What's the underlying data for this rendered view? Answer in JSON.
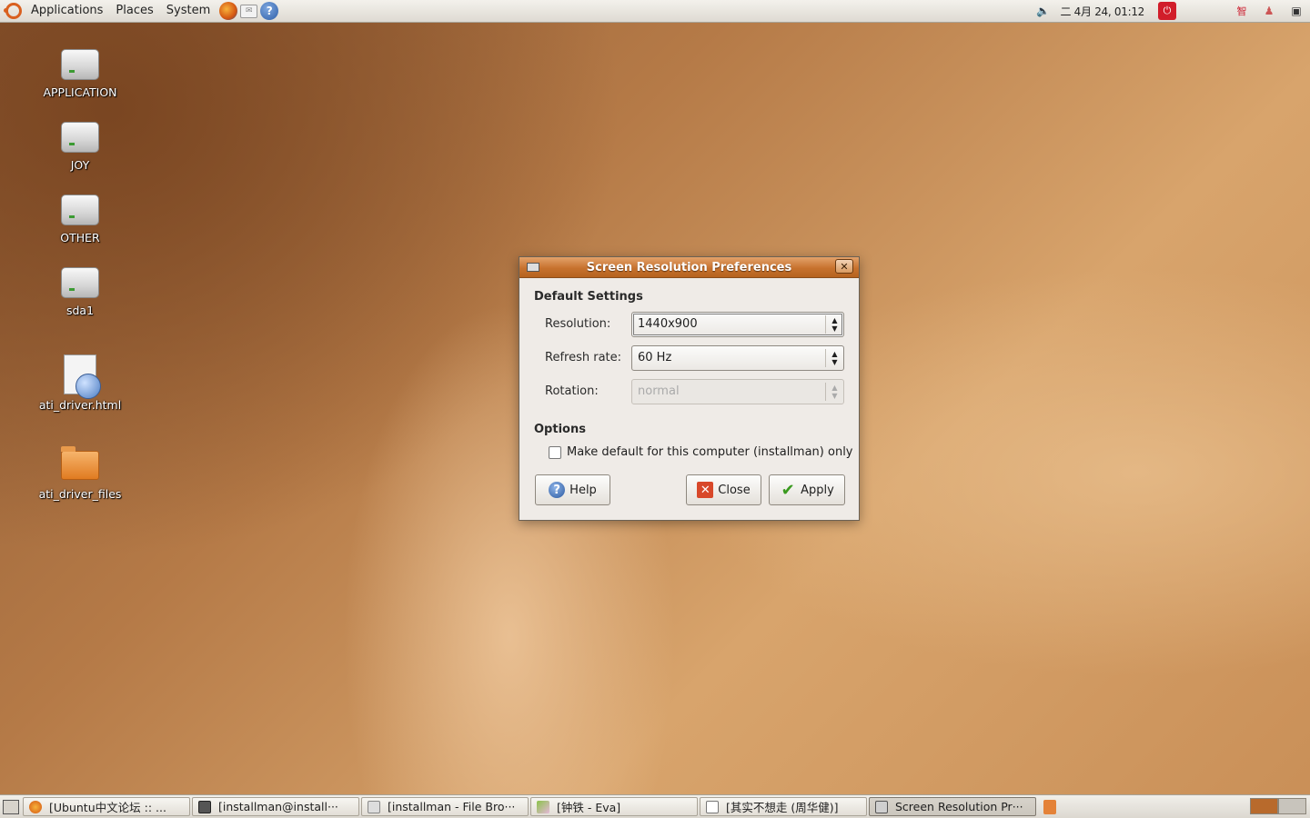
{
  "top_panel": {
    "menus": [
      "Applications",
      "Places",
      "System"
    ],
    "launchers": [
      "firefox-icon",
      "mail-icon",
      "help-icon"
    ],
    "clock": "二 4月 24, 01:12",
    "tray_icons": [
      "volume-icon",
      "power-icon",
      "input-method-icon",
      "user-icon",
      "network-icon"
    ]
  },
  "desktop": {
    "icons": [
      {
        "label": "APPLICATION",
        "icon": "drive-icon"
      },
      {
        "label": "JOY",
        "icon": "drive-icon"
      },
      {
        "label": "OTHER",
        "icon": "drive-icon"
      },
      {
        "label": "sda1",
        "icon": "drive-icon"
      },
      {
        "label": "ati_driver.html",
        "icon": "html-file-icon"
      },
      {
        "label": "ati_driver_files",
        "icon": "folder-icon"
      }
    ]
  },
  "dialog": {
    "title": "Screen Resolution Preferences",
    "section_default": "Default Settings",
    "resolution_label": "Resolution:",
    "resolution_value": "1440x900",
    "refresh_label": "Refresh rate:",
    "refresh_value": "60 Hz",
    "rotation_label": "Rotation:",
    "rotation_value": "normal",
    "section_options": "Options",
    "make_default_label": "Make default for this computer (installman) only",
    "make_default_checked": false,
    "help_button": "Help",
    "close_button": "Close",
    "apply_button": "Apply"
  },
  "taskbar": {
    "tasks": [
      {
        "label": "[Ubuntu中文论坛 :: ...",
        "active": false
      },
      {
        "label": "[installman@install···",
        "active": false
      },
      {
        "label": "[installman - File Bro···",
        "active": false
      },
      {
        "label": "[钟铁 - Eva]",
        "active": false
      },
      {
        "label": "[其实不想走 (周华健)]",
        "active": false
      },
      {
        "label": "Screen Resolution Pr···",
        "active": true
      }
    ]
  }
}
